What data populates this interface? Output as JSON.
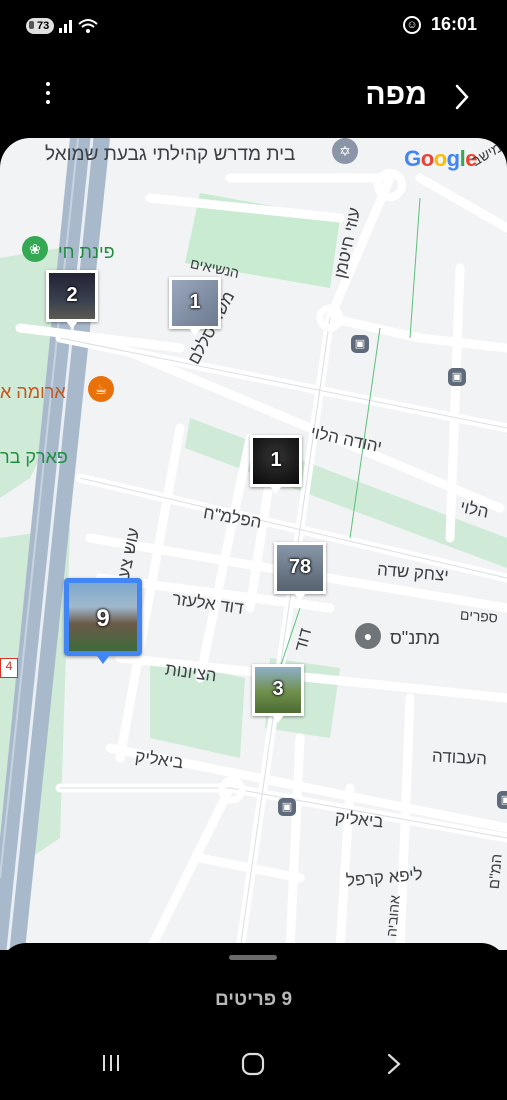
{
  "status": {
    "battery": "73",
    "signal_sup": "6",
    "time": "16:01"
  },
  "header": {
    "title": "מפה",
    "back_icon": "chevron-right-icon",
    "menu_icon": "more-vert-icon"
  },
  "map": {
    "labels": {
      "top_synagogue": "בית מדרש קהילתי גבעת שמואל",
      "top_right_partial": "עמישב",
      "pinat_chai": "פינת חי",
      "aroma": "ארומה א",
      "park": "פארק בר",
      "hanesiim": "הנשיאים",
      "moshe_salslem": "משה סללם",
      "uzi_chitman": "עוזי חיטמן",
      "yehuda_halevi": "יהודה הלוי",
      "yehuda_halevi_2": "הלוי",
      "hapalmach": "הפלמ\"ח",
      "yitzhak_sadeh": "יצחק שדה",
      "david_elazar": "דוד אלעזר",
      "oosh_tsa": "עוש צע",
      "david": "דוד",
      "matnas": "מתנ\"ס",
      "sfarim": "ספרים",
      "hatsiyonut": "הציונות",
      "haavoda": "העבודה",
      "bialik": "ביאליק",
      "bialik_2": "ביאליק",
      "lipa_karpel": "ליפא קרפל",
      "right_edge": "המ\"ם",
      "ahuvia": "אהוביה",
      "road_4": "4"
    },
    "google_logo": [
      "G",
      "o",
      "o",
      "g",
      "l",
      "e"
    ],
    "markers": [
      {
        "id": "marker-2",
        "count": "2",
        "bg": "#2b3340"
      },
      {
        "id": "marker-1a",
        "count": "1",
        "bg": "#8d9ab0"
      },
      {
        "id": "marker-1b",
        "count": "1",
        "bg": "#151515"
      },
      {
        "id": "marker-78",
        "count": "78",
        "bg": "#6f7f96"
      },
      {
        "id": "marker-9",
        "count": "9",
        "bg": "#5d7e98"
      },
      {
        "id": "marker-3",
        "count": "3",
        "bg": "#6e8a4a"
      }
    ]
  },
  "sheet": {
    "items_count": "9 פריטים"
  },
  "colors": {
    "accent": "#4285f4",
    "park": "#c8ebd2",
    "road": "#ffffff",
    "highway": "#8fa3bc"
  }
}
